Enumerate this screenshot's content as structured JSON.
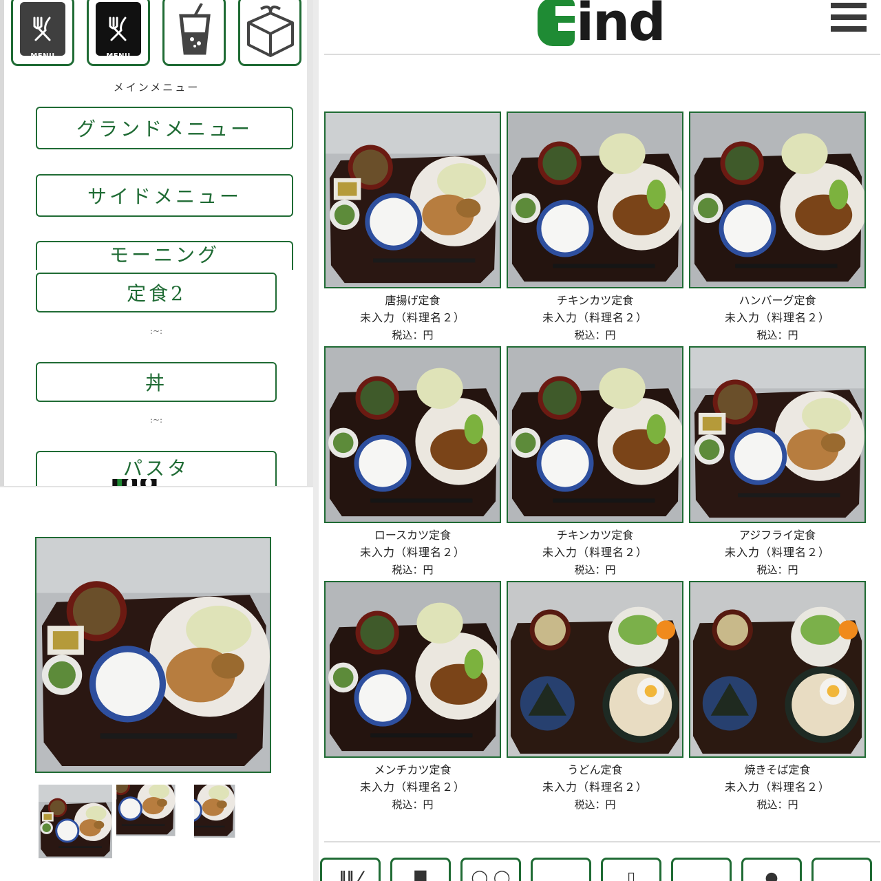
{
  "left_menu": {
    "icons": [
      {
        "name": "menu-book-icon",
        "label": "MENU"
      },
      {
        "name": "menu-book-icon",
        "label": "MENU"
      },
      {
        "name": "drink-icon",
        "label": ""
      },
      {
        "name": "takeout-box-icon",
        "label": ""
      }
    ],
    "section_title": "メインメニュー",
    "buttons": [
      "グランドメニュー",
      "サイドメニュー",
      "モーニング"
    ],
    "sub_buttons": [
      "定食2",
      "丼",
      "パスタ"
    ],
    "separator": ":~:"
  },
  "header": {
    "logo_text": "ind",
    "menu_icon": "hamburger-icon"
  },
  "products": [
    {
      "name": "唐揚げ定食",
      "sub": "未入力（料理名２）",
      "price": "税込：円"
    },
    {
      "name": "チキンカツ定食",
      "sub": "未入力（料理名２）",
      "price": "税込：円"
    },
    {
      "name": "ハンバーグ定食",
      "sub": "未入力（料理名２）",
      "price": "税込：円"
    },
    {
      "name": "ロースカツ定食",
      "sub": "未入力（料理名２）",
      "price": "税込：円"
    },
    {
      "name": "チキンカツ定食",
      "sub": "未入力（料理名２）",
      "price": "税込：円"
    },
    {
      "name": "アジフライ定食",
      "sub": "未入力（料理名２）",
      "price": "税込：円"
    },
    {
      "name": "メンチカツ定食",
      "sub": "未入力（料理名２）",
      "price": "税込：円"
    },
    {
      "name": "うどん定食",
      "sub": "未入力（料理名２）",
      "price": "税込：円"
    },
    {
      "name": "焼きそば定食",
      "sub": "未入力（料理名２）",
      "price": "税込：円"
    }
  ],
  "footer_nav_icons": [
    "cutlery-icon",
    "bag-icon",
    "glasses-icon",
    "box-icon",
    "phone-icon",
    "map-icon",
    "person-icon",
    "more-icon"
  ],
  "colors": {
    "accent": "#1f6b34",
    "logo_green": "#1f8b34"
  }
}
